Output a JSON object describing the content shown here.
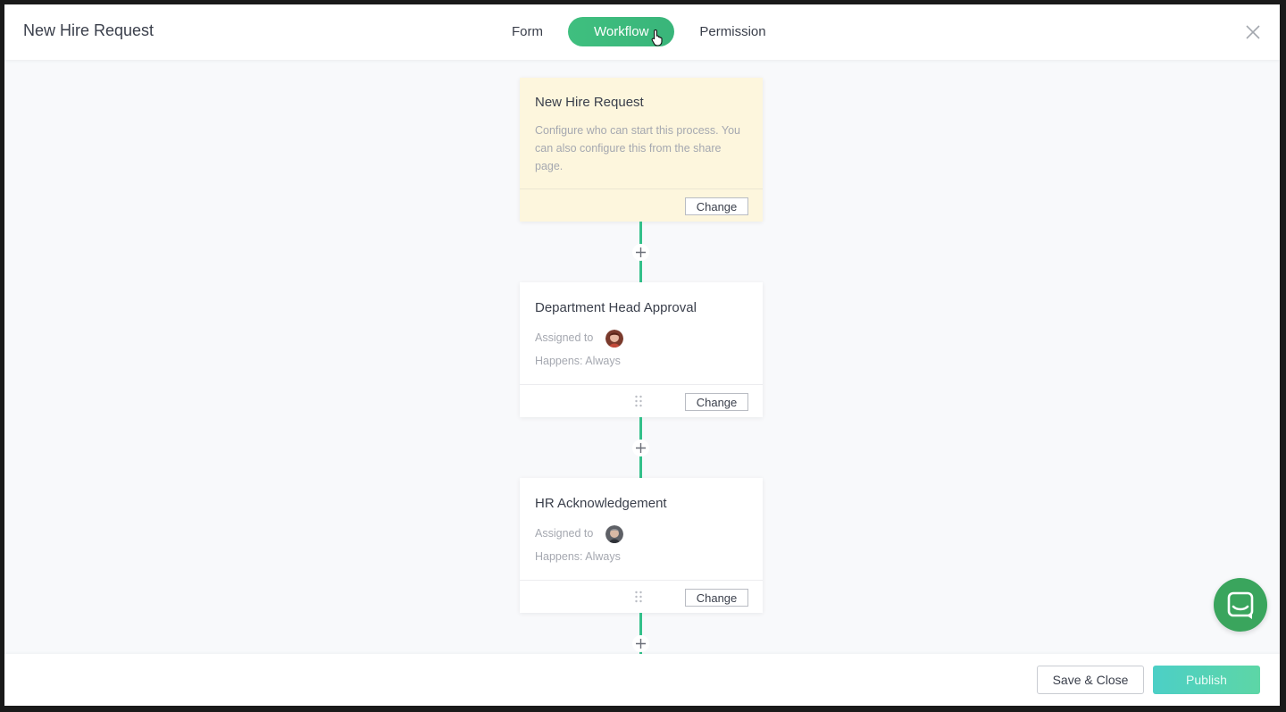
{
  "header": {
    "title": "New Hire Request",
    "tabs": [
      {
        "label": "Form",
        "active": false
      },
      {
        "label": "Workflow",
        "active": true
      },
      {
        "label": "Permission",
        "active": false
      }
    ],
    "close_icon": "close-icon"
  },
  "workflow": {
    "start_step": {
      "title": "New Hire Request",
      "description": "Configure who can start this process. You can also configure this from the share page.",
      "change_label": "Change"
    },
    "steps": [
      {
        "title": "Department Head Approval",
        "assigned_label": "Assigned to",
        "happens": "Happens: Always",
        "change_label": "Change"
      },
      {
        "title": "HR Acknowledgement",
        "assigned_label": "Assigned to",
        "happens": "Happens: Always",
        "change_label": "Change"
      }
    ],
    "add_step_icon": "plus-icon"
  },
  "footer": {
    "save_label": "Save & Close",
    "publish_label": "Publish"
  },
  "colors": {
    "accent_green": "#36b37e",
    "connector": "#33c08a",
    "start_card_bg": "#fdf6dd",
    "publish_gradient_start": "#4ccfc6",
    "publish_gradient_end": "#5dd6a6",
    "chat_button": "#3aa55d"
  },
  "chat_icon": "chat-bubble-icon"
}
